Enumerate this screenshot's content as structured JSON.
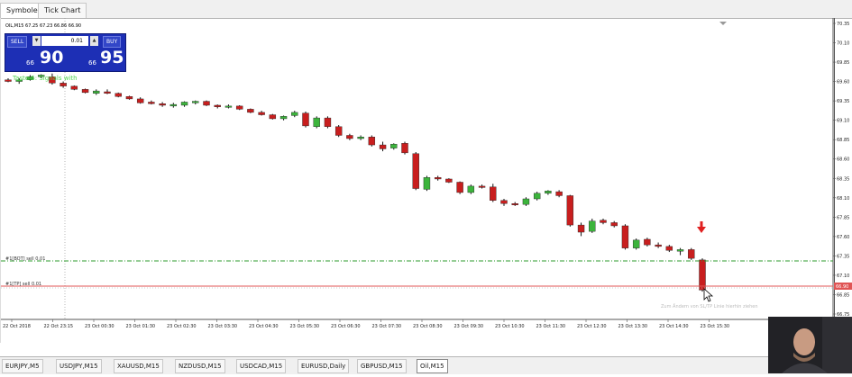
{
  "window_tabs": [
    {
      "label": "Symbole"
    },
    {
      "label": "Tick Chart"
    }
  ],
  "chart_header": "OIL,M15  67.25 67.23 66.86 66.90",
  "trade_panel": {
    "sell_label": "SELL",
    "buy_label": "BUY",
    "lot_value": "0.01",
    "bid_small": "66",
    "bid_big": "90",
    "ask_small": "66",
    "ask_big": "95"
  },
  "signal_text": "Taste 5: Signals with",
  "price_axis": {
    "labels": [
      "70.35",
      "70.10",
      "69.85",
      "69.60",
      "69.35",
      "69.10",
      "68.85",
      "68.60",
      "68.35",
      "68.10",
      "67.85",
      "67.60",
      "67.35",
      "67.10",
      "66.85",
      "66.75"
    ],
    "current_price": "66.90"
  },
  "time_axis": {
    "labels": [
      "22 Oct 2018",
      "22 Oct 23:15",
      "23 Oct 00:30",
      "23 Oct 01:30",
      "23 Oct 02:30",
      "23 Oct 03:30",
      "23 Oct 04:30",
      "23 Oct 05:30",
      "23 Oct 06:30",
      "23 Oct 07:30",
      "23 Oct 08:30",
      "23 Oct 09:30",
      "23 Oct 10:30",
      "23 Oct 11:30",
      "23 Oct 12:30",
      "23 Oct 13:30",
      "23 Oct 14:30",
      "23 Oct 15:30"
    ]
  },
  "lines": {
    "upper_label": "#1[BOT] sell 0.01",
    "lower_label": "#1[TP] sell 0.01"
  },
  "tp_hint": "Zum Ändern von SL/TP Linie hierhin ziehen",
  "symbol_tabs": [
    {
      "label": "EURJPY,M5",
      "active": false
    },
    {
      "label": "USDJPY,M15",
      "active": false
    },
    {
      "label": "XAUUSD,M15",
      "active": false
    },
    {
      "label": "NZDUSD,M15",
      "active": false
    },
    {
      "label": "USDCAD,M15",
      "active": false
    },
    {
      "label": "EURUSD,Daily",
      "active": false
    },
    {
      "label": "GBPUSD,M15",
      "active": false
    },
    {
      "label": "Oil,M15",
      "active": true
    }
  ],
  "colors": {
    "bull": "#3cb43c",
    "bear": "#c81e1e",
    "panel": "#1d2fb5",
    "green_line": "#2e9b2e",
    "red_line": "#e05555",
    "arrow": "#e02020"
  },
  "chart_data": {
    "type": "candlestick",
    "symbol": "OIL,M15",
    "y_range": [
      66.7,
      70.5
    ],
    "candles": [
      {
        "o": 69.72,
        "h": 69.74,
        "l": 69.69,
        "c": 69.7
      },
      {
        "o": 69.7,
        "h": 69.74,
        "l": 69.67,
        "c": 69.72
      },
      {
        "o": 69.72,
        "h": 69.78,
        "l": 69.71,
        "c": 69.76
      },
      {
        "o": 69.76,
        "h": 69.79,
        "l": 69.74,
        "c": 69.78
      },
      {
        "o": 69.76,
        "h": 69.8,
        "l": 69.66,
        "c": 69.68
      },
      {
        "o": 69.68,
        "h": 69.7,
        "l": 69.62,
        "c": 69.64
      },
      {
        "o": 69.64,
        "h": 69.65,
        "l": 69.59,
        "c": 69.6
      },
      {
        "o": 69.6,
        "h": 69.61,
        "l": 69.55,
        "c": 69.56
      },
      {
        "o": 69.55,
        "h": 69.6,
        "l": 69.53,
        "c": 69.58
      },
      {
        "o": 69.57,
        "h": 69.6,
        "l": 69.54,
        "c": 69.55
      },
      {
        "o": 69.55,
        "h": 69.56,
        "l": 69.5,
        "c": 69.51
      },
      {
        "o": 69.51,
        "h": 69.52,
        "l": 69.47,
        "c": 69.48
      },
      {
        "o": 69.48,
        "h": 69.5,
        "l": 69.42,
        "c": 69.43
      },
      {
        "o": 69.44,
        "h": 69.46,
        "l": 69.41,
        "c": 69.42
      },
      {
        "o": 69.42,
        "h": 69.44,
        "l": 69.38,
        "c": 69.4
      },
      {
        "o": 69.39,
        "h": 69.43,
        "l": 69.37,
        "c": 69.41
      },
      {
        "o": 69.4,
        "h": 69.45,
        "l": 69.38,
        "c": 69.44
      },
      {
        "o": 69.43,
        "h": 69.46,
        "l": 69.41,
        "c": 69.45
      },
      {
        "o": 69.45,
        "h": 69.46,
        "l": 69.39,
        "c": 69.4
      },
      {
        "o": 69.4,
        "h": 69.41,
        "l": 69.36,
        "c": 69.38
      },
      {
        "o": 69.38,
        "h": 69.41,
        "l": 69.36,
        "c": 69.39
      },
      {
        "o": 69.39,
        "h": 69.4,
        "l": 69.34,
        "c": 69.35
      },
      {
        "o": 69.35,
        "h": 69.36,
        "l": 69.3,
        "c": 69.31
      },
      {
        "o": 69.31,
        "h": 69.33,
        "l": 69.27,
        "c": 69.28
      },
      {
        "o": 69.28,
        "h": 69.29,
        "l": 69.22,
        "c": 69.23
      },
      {
        "o": 69.23,
        "h": 69.27,
        "l": 69.21,
        "c": 69.26
      },
      {
        "o": 69.27,
        "h": 69.33,
        "l": 69.25,
        "c": 69.31
      },
      {
        "o": 69.3,
        "h": 69.32,
        "l": 69.12,
        "c": 69.14
      },
      {
        "o": 69.13,
        "h": 69.26,
        "l": 69.11,
        "c": 69.24
      },
      {
        "o": 69.24,
        "h": 69.26,
        "l": 69.11,
        "c": 69.13
      },
      {
        "o": 69.13,
        "h": 69.15,
        "l": 69.0,
        "c": 69.02
      },
      {
        "o": 69.02,
        "h": 69.04,
        "l": 68.96,
        "c": 68.98
      },
      {
        "o": 68.98,
        "h": 69.02,
        "l": 68.96,
        "c": 69.0
      },
      {
        "o": 69.0,
        "h": 69.02,
        "l": 68.88,
        "c": 68.9
      },
      {
        "o": 68.9,
        "h": 68.94,
        "l": 68.82,
        "c": 68.85
      },
      {
        "o": 68.86,
        "h": 68.92,
        "l": 68.84,
        "c": 68.91
      },
      {
        "o": 68.92,
        "h": 68.94,
        "l": 68.78,
        "c": 68.8
      },
      {
        "o": 68.79,
        "h": 68.81,
        "l": 68.33,
        "c": 68.35
      },
      {
        "o": 68.34,
        "h": 68.51,
        "l": 68.32,
        "c": 68.49
      },
      {
        "o": 68.49,
        "h": 68.51,
        "l": 68.45,
        "c": 68.47
      },
      {
        "o": 68.47,
        "h": 68.48,
        "l": 68.42,
        "c": 68.43
      },
      {
        "o": 68.43,
        "h": 68.44,
        "l": 68.28,
        "c": 68.3
      },
      {
        "o": 68.3,
        "h": 68.4,
        "l": 68.28,
        "c": 68.38
      },
      {
        "o": 68.38,
        "h": 68.4,
        "l": 68.35,
        "c": 68.37
      },
      {
        "o": 68.37,
        "h": 68.41,
        "l": 68.18,
        "c": 68.2
      },
      {
        "o": 68.2,
        "h": 68.22,
        "l": 68.13,
        "c": 68.16
      },
      {
        "o": 68.16,
        "h": 68.18,
        "l": 68.13,
        "c": 68.15
      },
      {
        "o": 68.15,
        "h": 68.24,
        "l": 68.13,
        "c": 68.22
      },
      {
        "o": 68.22,
        "h": 68.31,
        "l": 68.2,
        "c": 68.29
      },
      {
        "o": 68.29,
        "h": 68.33,
        "l": 68.27,
        "c": 68.32
      },
      {
        "o": 68.31,
        "h": 68.33,
        "l": 68.24,
        "c": 68.26
      },
      {
        "o": 68.26,
        "h": 68.27,
        "l": 67.87,
        "c": 67.89
      },
      {
        "o": 67.89,
        "h": 67.92,
        "l": 67.75,
        "c": 67.8
      },
      {
        "o": 67.81,
        "h": 67.97,
        "l": 67.79,
        "c": 67.94
      },
      {
        "o": 67.95,
        "h": 67.97,
        "l": 67.9,
        "c": 67.92
      },
      {
        "o": 67.92,
        "h": 67.94,
        "l": 67.86,
        "c": 67.88
      },
      {
        "o": 67.88,
        "h": 67.9,
        "l": 67.58,
        "c": 67.6
      },
      {
        "o": 67.6,
        "h": 67.72,
        "l": 67.58,
        "c": 67.7
      },
      {
        "o": 67.71,
        "h": 67.73,
        "l": 67.62,
        "c": 67.64
      },
      {
        "o": 67.64,
        "h": 67.67,
        "l": 67.6,
        "c": 67.62
      },
      {
        "o": 67.62,
        "h": 67.64,
        "l": 67.55,
        "c": 67.57
      },
      {
        "o": 67.56,
        "h": 67.6,
        "l": 67.51,
        "c": 67.58
      },
      {
        "o": 67.58,
        "h": 67.6,
        "l": 67.45,
        "c": 67.47
      },
      {
        "o": 67.45,
        "h": 67.47,
        "l": 67.05,
        "c": 67.07
      }
    ]
  }
}
